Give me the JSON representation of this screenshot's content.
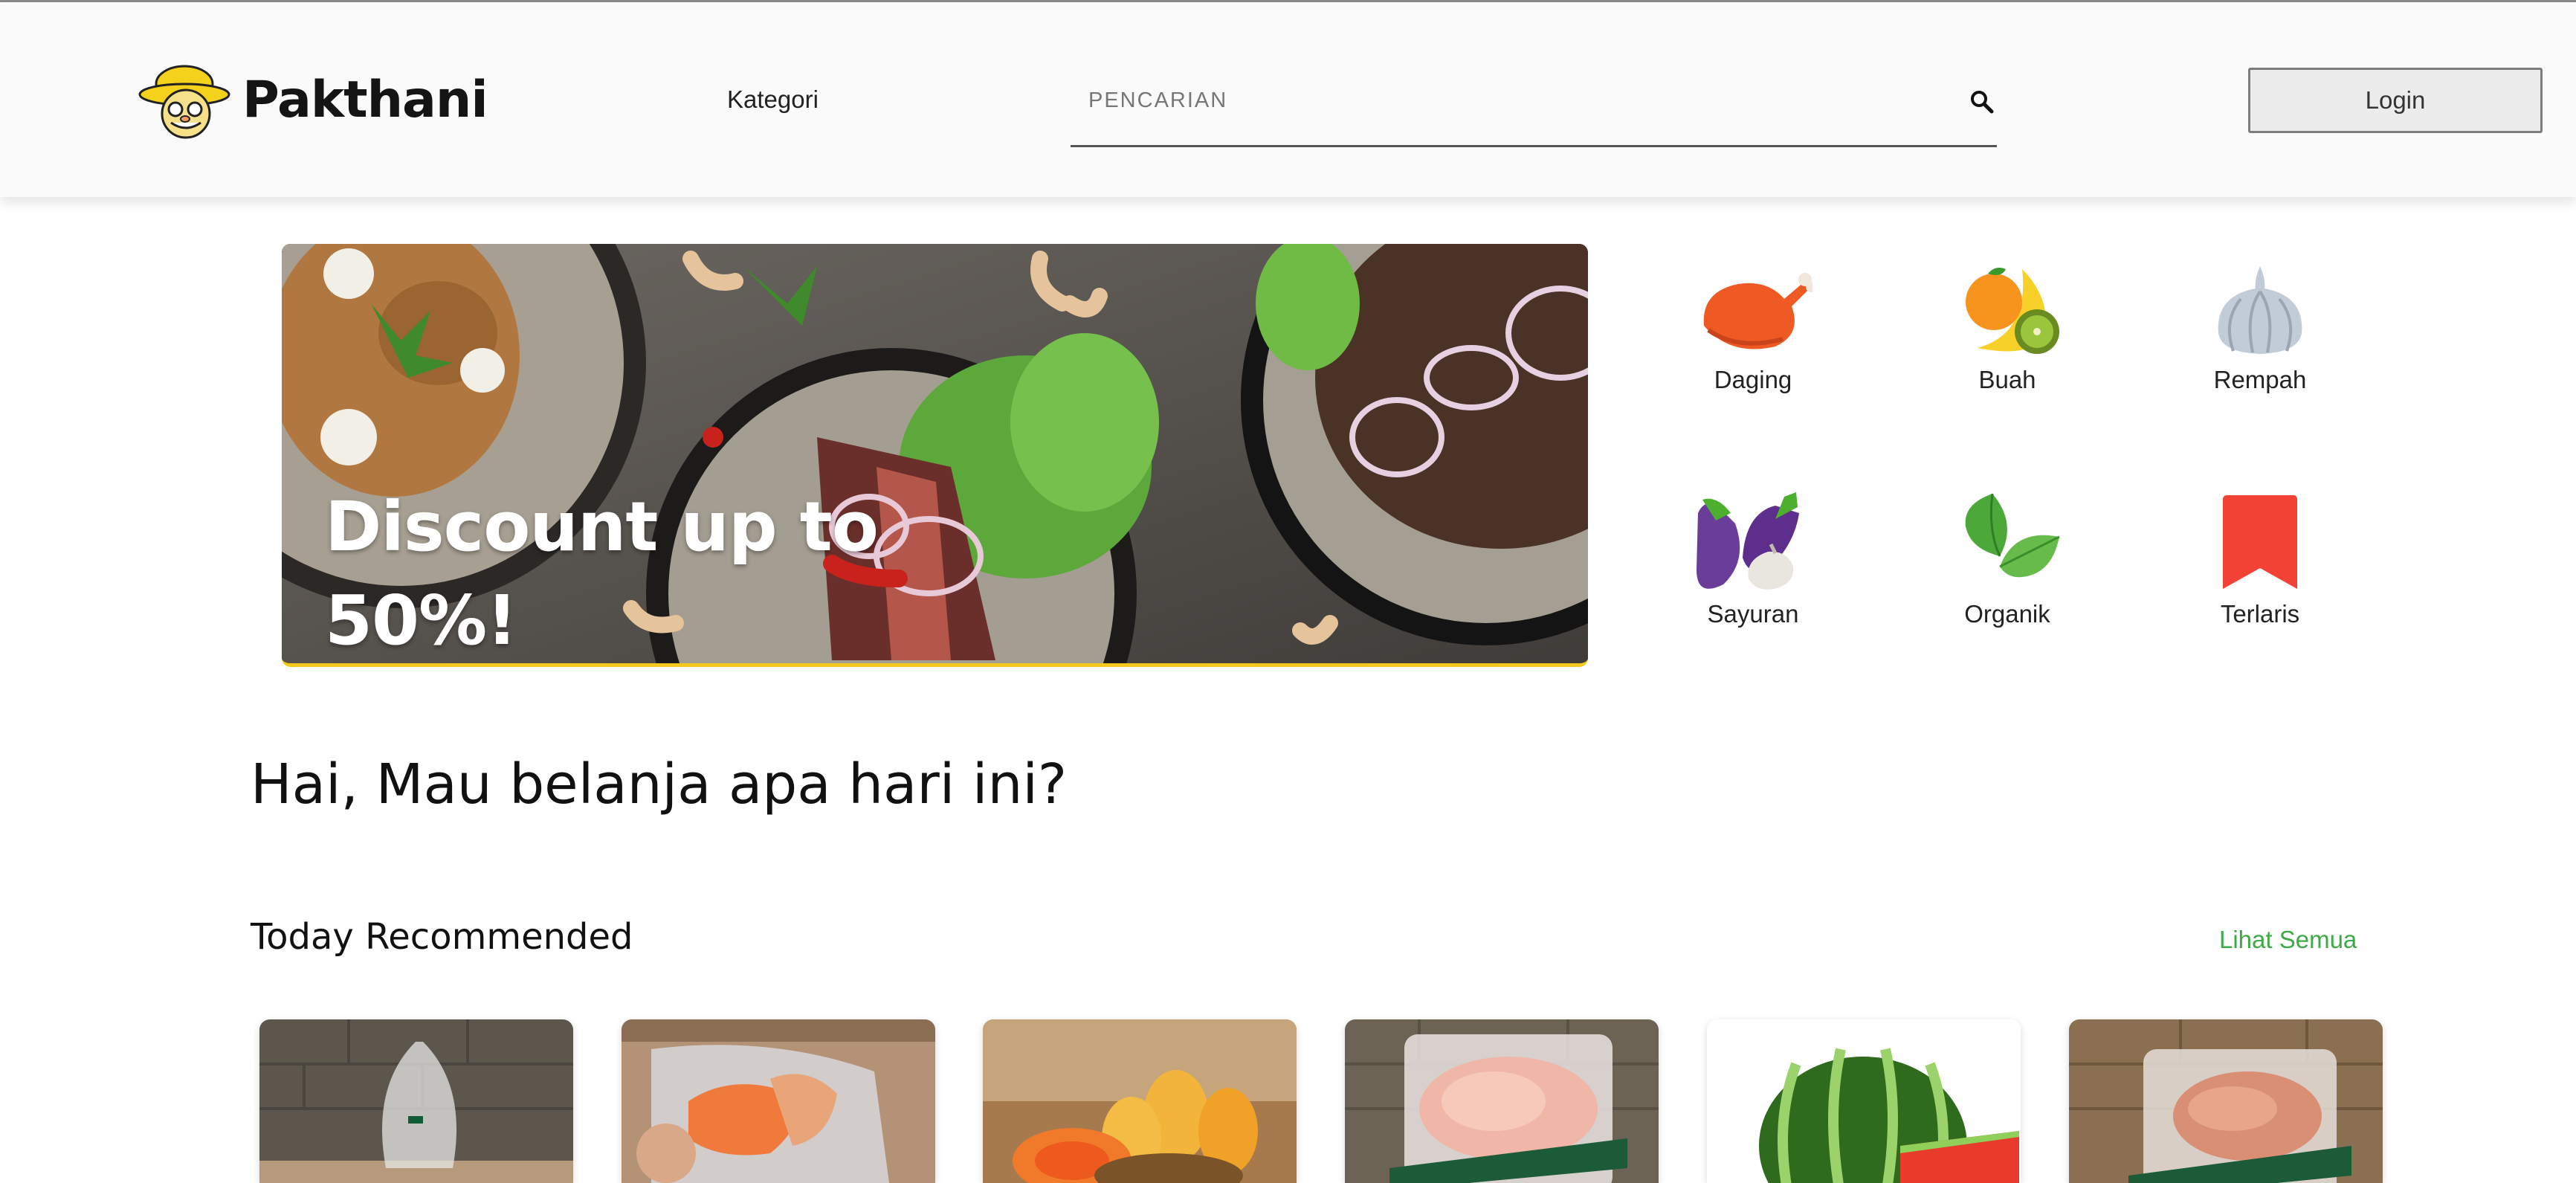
{
  "header": {
    "brand": "Pakthani",
    "nav_kategori": "Kategori",
    "search_placeholder": "PENCARIAN",
    "login_label": "Login"
  },
  "banner": {
    "headline_line1": "Discount up to",
    "headline_line2": "50%!"
  },
  "categories": [
    {
      "label": "Daging",
      "icon": "meat-icon"
    },
    {
      "label": "Buah",
      "icon": "fruit-icon"
    },
    {
      "label": "Rempah",
      "icon": "garlic-icon"
    },
    {
      "label": "Sayuran",
      "icon": "vegetable-icon"
    },
    {
      "label": "Organik",
      "icon": "leaf-icon"
    },
    {
      "label": "Terlaris",
      "icon": "bookmark-icon"
    }
  ],
  "greeting": "Hai, Mau belanja apa hari ini?",
  "recommended": {
    "title": "Today Recommended",
    "see_all": "Lihat Semua"
  },
  "colors": {
    "accent_green": "#3daa47",
    "banner_border": "#f4c81c",
    "terlaris_red": "#f24235"
  }
}
